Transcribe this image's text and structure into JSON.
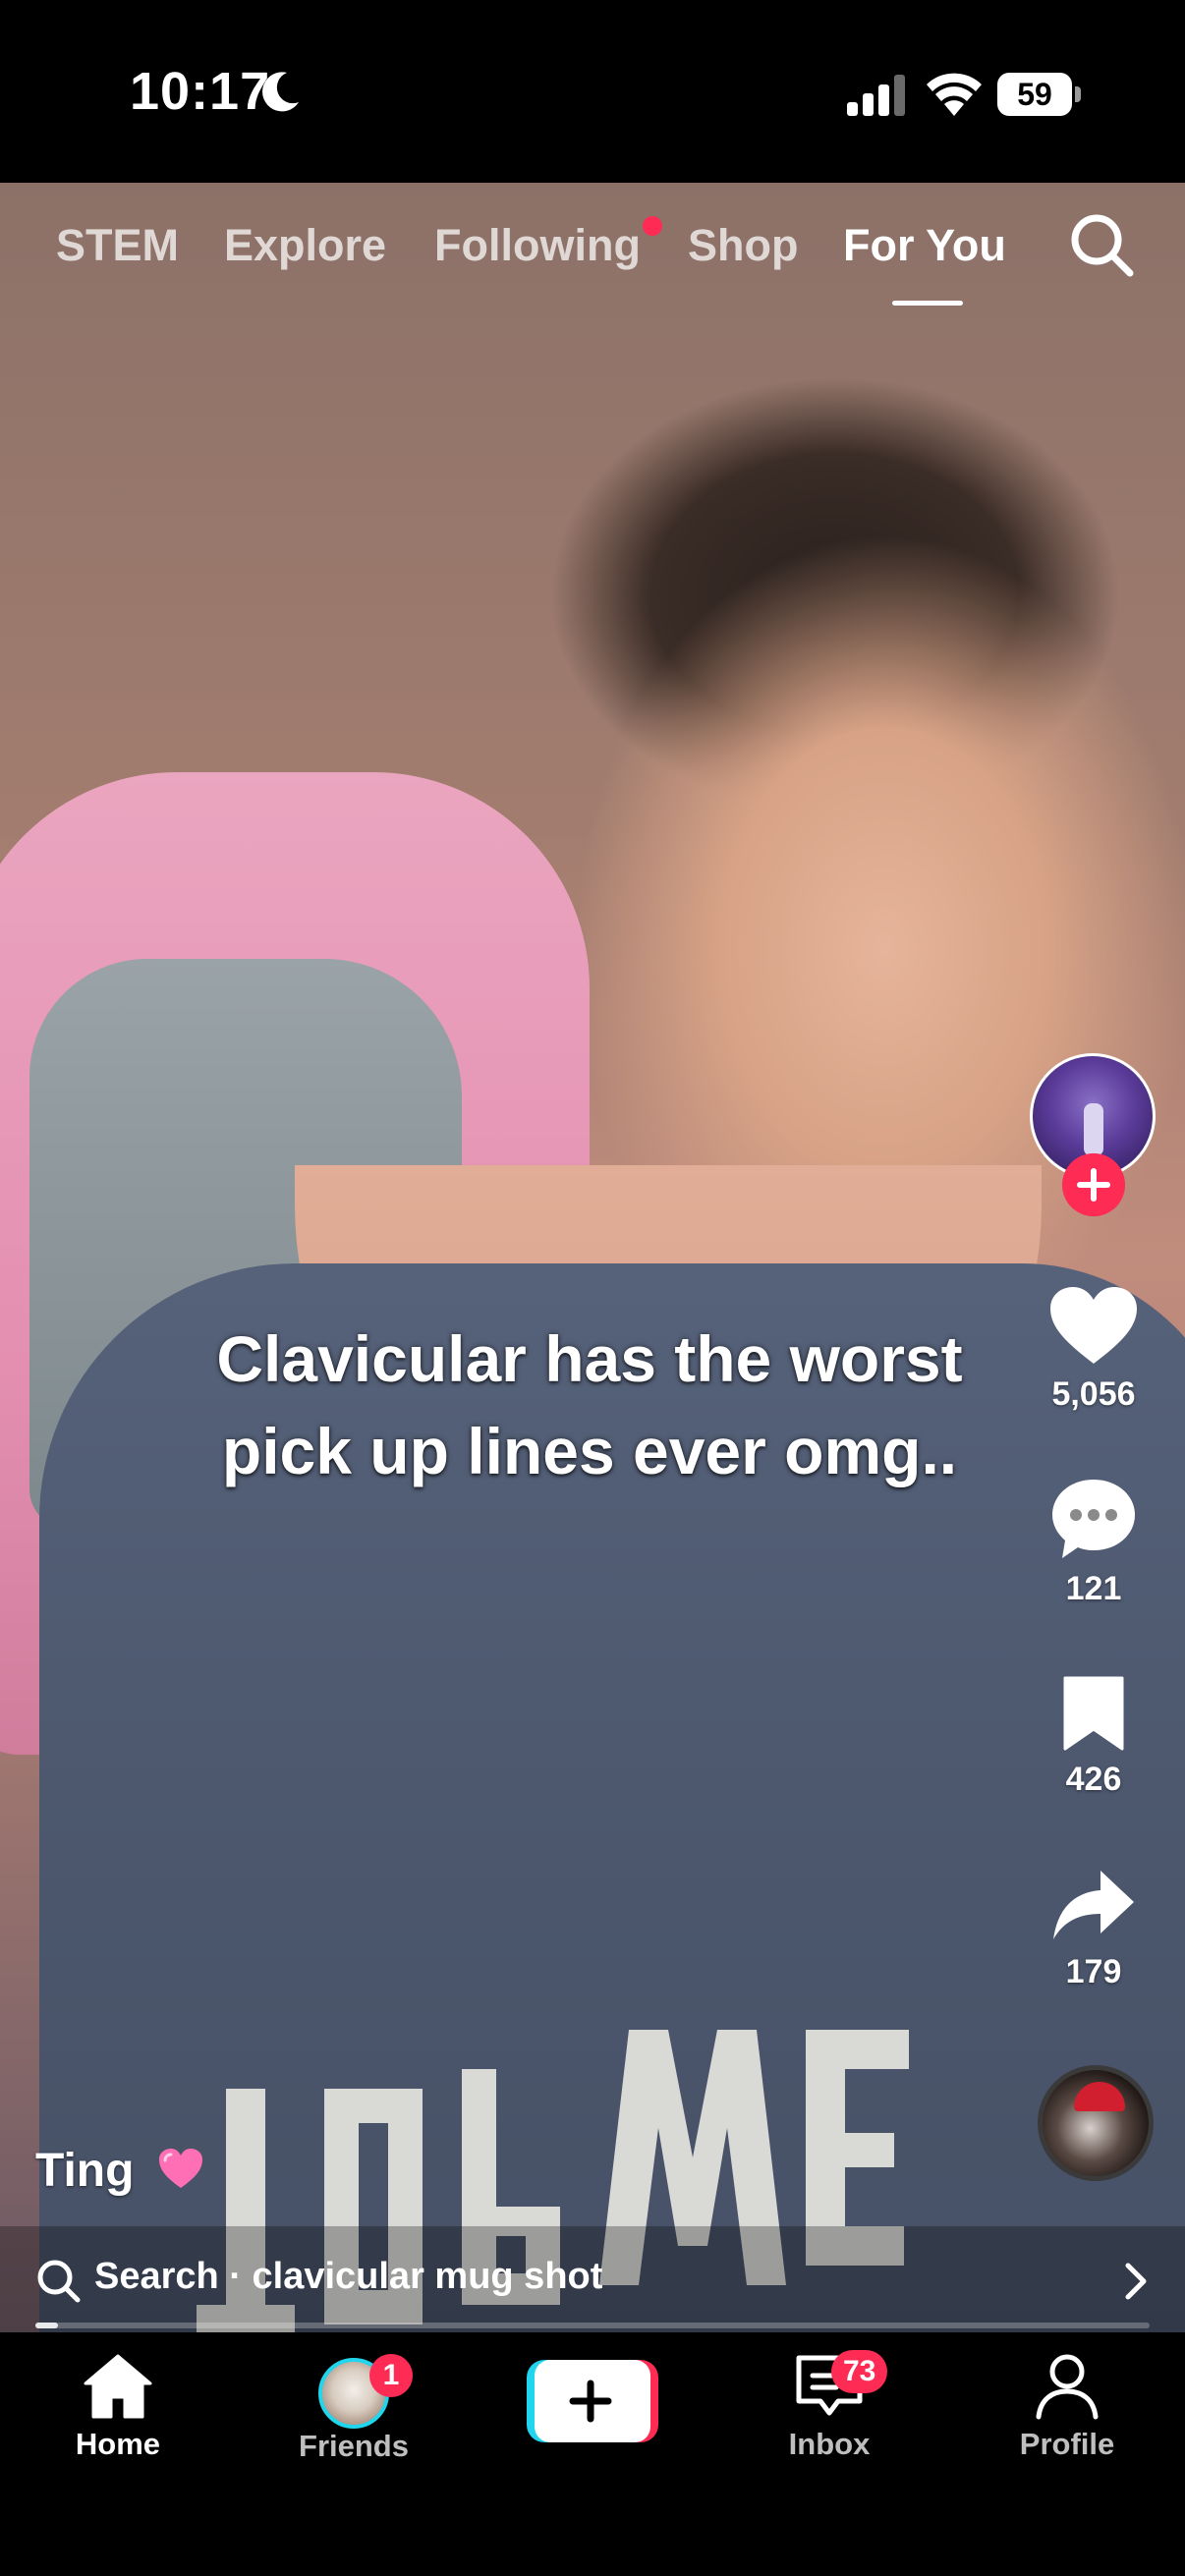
{
  "status_bar": {
    "time": "10:17",
    "battery": "59",
    "icons": [
      "moon-icon",
      "cellular-signal-icon",
      "wifi-icon",
      "battery-icon"
    ]
  },
  "top_tabs": {
    "items": [
      "STEM",
      "Explore",
      "Following",
      "Shop",
      "For You"
    ],
    "active": "For You",
    "following_has_new_dot": true,
    "search_icon": "search-icon"
  },
  "video": {
    "caption": "Clavicular has the worst pick up lines ever omg.."
  },
  "creator": {
    "username": "Ting",
    "username_emoji": "pink-heart-emoji"
  },
  "actions": {
    "likes": "5,056",
    "comments": "121",
    "saves": "426",
    "shares": "179"
  },
  "search_suggestion": {
    "text": "Search · clavicular mug shot"
  },
  "playback": {
    "progress_fraction": 0.02
  },
  "bottom_nav": {
    "home": "Home",
    "friends": "Friends",
    "friends_badge": "1",
    "inbox": "Inbox",
    "inbox_badge": "73",
    "profile": "Profile",
    "active": "Home"
  },
  "colors": {
    "accent_red": "#fe2c55",
    "accent_cyan": "#20d5ec"
  }
}
